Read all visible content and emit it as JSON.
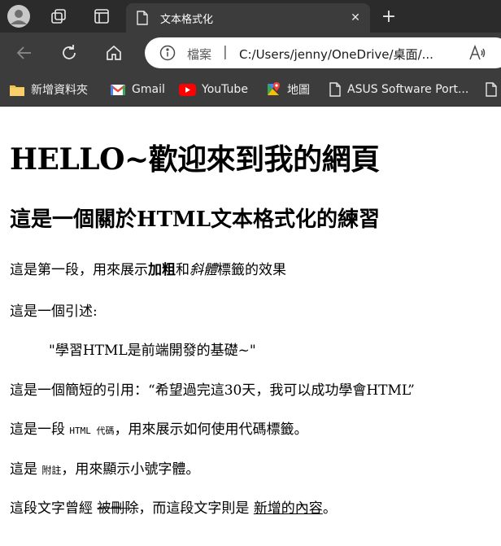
{
  "browser": {
    "tab": {
      "title": "文本格式化"
    },
    "new_tab_label": "+",
    "address": {
      "scheme_label": "檔案",
      "separator": "|",
      "url": "C:/Users/jenny/OneDrive/桌面/..."
    },
    "bookmarks": [
      {
        "label": "新增資料夾",
        "icon": "folder-icon"
      },
      {
        "label": "Gmail",
        "icon": "gmail-icon"
      },
      {
        "label": "YouTube",
        "icon": "youtube-icon"
      },
      {
        "label": "地圖",
        "icon": "maps-icon"
      },
      {
        "label": "ASUS Software Port...",
        "icon": "page-icon"
      }
    ]
  },
  "page": {
    "heading1": "HELLO~歡迎來到我的網頁",
    "heading2": "這是一個關於HTML文本格式化的練習",
    "p1": {
      "before": "這是第一段，用來展示",
      "bold": "加粗",
      "mid": "和",
      "italic": "斜體",
      "after": "標籤的效果"
    },
    "p2": "這是一個引述:",
    "blockquote": "\"學習HTML是前端開發的基礎~\"",
    "p3": {
      "before": "這是一個簡短的引用：",
      "quote": "“希望過完這30天，我可以成功學會HTML”"
    },
    "p4": {
      "before": "這是一段 ",
      "code": "HTML 代碼",
      "after": "，用來展示如何使用代碼標籤。"
    },
    "p5": {
      "before": "這是 ",
      "small": "附註",
      "after": "，用來顯示小號字體。"
    },
    "p6": {
      "before": "這段文字曾經 ",
      "deleted": "被刪除",
      "mid": "，而這段文字則是 ",
      "inserted": "新增的內容",
      "after": "。"
    }
  }
}
